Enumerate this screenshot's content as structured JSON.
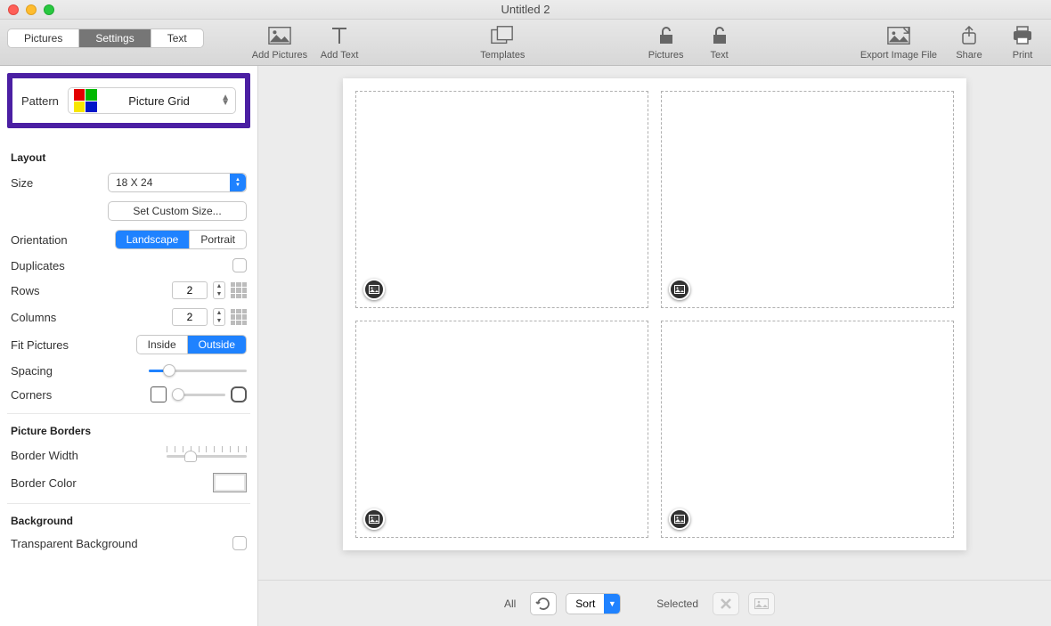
{
  "window": {
    "title": "Untitled 2"
  },
  "tabs": {
    "pictures": "Pictures",
    "settings": "Settings",
    "text": "Text",
    "active": "settings"
  },
  "toolbar": {
    "add_pictures": "Add Pictures",
    "add_text": "Add Text",
    "templates": "Templates",
    "lock_pictures": "Pictures",
    "lock_text": "Text",
    "export": "Export Image File",
    "share": "Share",
    "print": "Print"
  },
  "sidebar": {
    "pattern": {
      "label": "Pattern",
      "value": "Picture Grid"
    },
    "layout": {
      "heading": "Layout",
      "size_label": "Size",
      "size_value": "18 X 24",
      "custom_size": "Set Custom Size...",
      "orientation_label": "Orientation",
      "orientation_landscape": "Landscape",
      "orientation_portrait": "Portrait",
      "orientation_active": "landscape",
      "duplicates_label": "Duplicates",
      "rows_label": "Rows",
      "rows_value": "2",
      "columns_label": "Columns",
      "columns_value": "2",
      "fit_label": "Fit Pictures",
      "fit_inside": "Inside",
      "fit_outside": "Outside",
      "fit_active": "outside",
      "spacing_label": "Spacing",
      "corners_label": "Corners"
    },
    "borders": {
      "heading": "Picture Borders",
      "width_label": "Border Width",
      "color_label": "Border Color"
    },
    "background": {
      "heading": "Background",
      "transparent_label": "Transparent Background"
    }
  },
  "footer": {
    "all": "All",
    "sort": "Sort",
    "selected": "Selected"
  }
}
